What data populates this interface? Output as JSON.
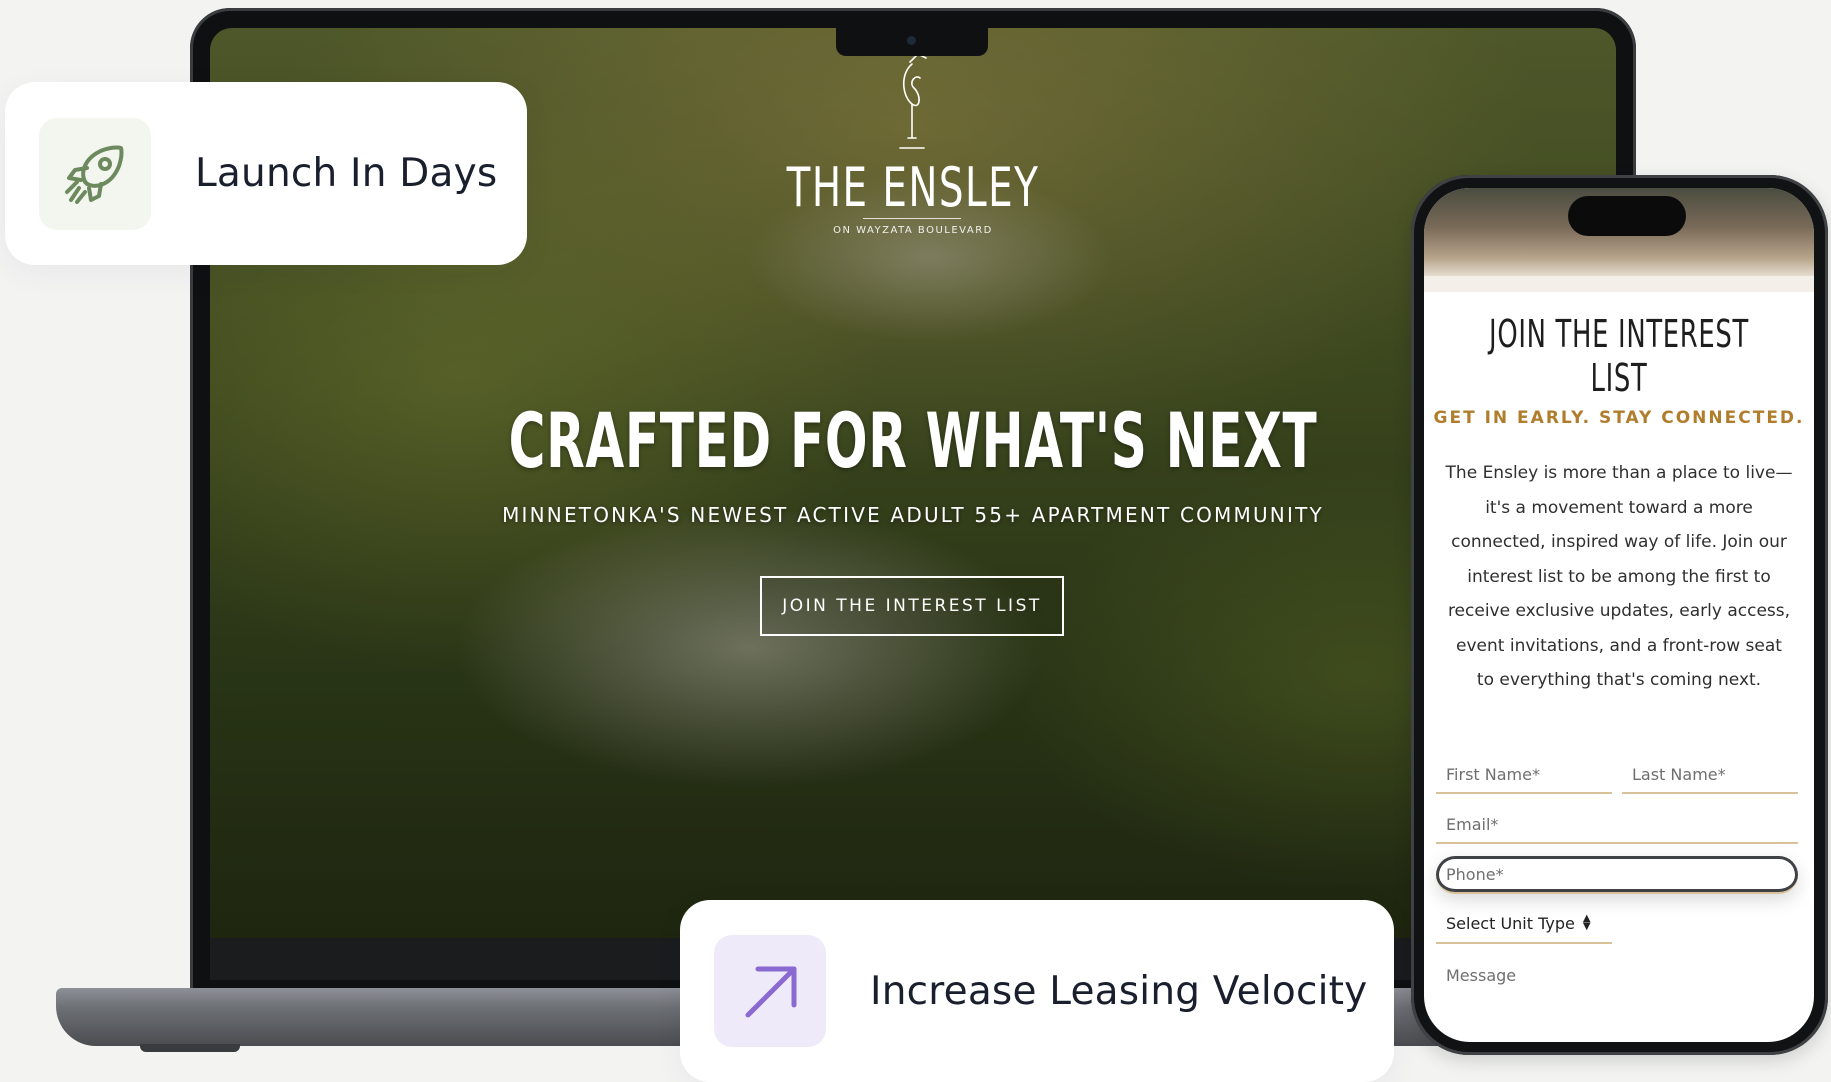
{
  "feature_cards": {
    "launch": {
      "label": "Launch In Days",
      "icon": "rocket-icon",
      "icon_color": "#6c8a5d"
    },
    "leasing": {
      "label": "Increase Leasing Velocity",
      "icon": "arrow-up-right-icon",
      "icon_color": "#8a6ad1"
    }
  },
  "laptop_site": {
    "brand": {
      "name": "THE ENSLEY",
      "subtitle": "ON WAYZATA BOULEVARD",
      "logo_icon": "heron-bird-icon"
    },
    "hero": {
      "title": "CRAFTED FOR WHAT'S NEXT",
      "subtitle": "MINNETONKA'S NEWEST ACTIVE ADULT 55+ APARTMENT COMMUNITY",
      "cta_label": "JOIN THE INTEREST LIST"
    }
  },
  "phone_site": {
    "title": "JOIN THE INTEREST LIST",
    "tagline": "GET IN EARLY. STAY CONNECTED.",
    "body_lines": [
      "The Ensley is more than a place to live—",
      "it's a movement toward a more",
      "connected, inspired way of life. Join our",
      "interest list to be among the first to",
      "receive exclusive updates, early access,",
      "event invitations, and a front-row seat",
      "to everything that's coming next."
    ],
    "form": {
      "first_name_placeholder": "First Name*",
      "last_name_placeholder": "Last Name*",
      "email_placeholder": "Email*",
      "phone_placeholder": "Phone*",
      "unit_type_selected": "Select Unit Type",
      "message_placeholder": "Message"
    },
    "accent_color": "#b07d2c"
  }
}
